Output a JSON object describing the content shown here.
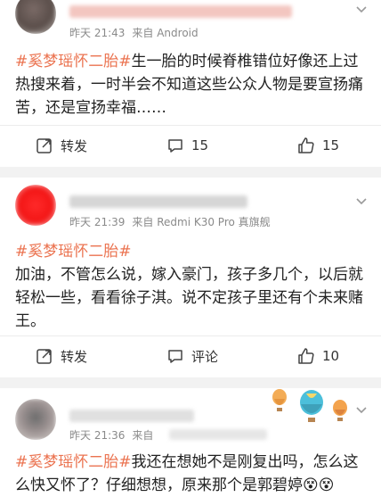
{
  "colors": {
    "topic": "#eb7350",
    "meta": "#8a8a8a",
    "separator": "#f2f2f2"
  },
  "posts": [
    {
      "time": "昨天 21:43",
      "source": "来自 Android",
      "topic": "#奚梦瑶怀二胎#",
      "text": "生一胎的时候脊椎错位好像还上过热搜来着，一时半会不知道这些公众人物是要宣扬痛苦，还是宣扬幸福……",
      "repost_label": "转发",
      "comment_count": "15",
      "like_count": "15"
    },
    {
      "time": "昨天 21:39",
      "source": "来自 Redmi K30 Pro 真旗舰",
      "topic": "#奚梦瑶怀二胎#",
      "text": "加油，不管怎么说，嫁入豪门，孩子多几个，以后就轻松一些，看看徐子淇。说不定孩子里还有个未来赌王。",
      "repost_label": "转发",
      "comment_label": "评论",
      "like_count": "10"
    },
    {
      "time": "昨天 21:36",
      "source": "来自",
      "topic": "#奚梦瑶怀二胎#",
      "text": "我还在想她不是刚复出吗，怎么这么快又怀了？仔细想想，原来那个是郭碧婷😵😵"
    }
  ]
}
